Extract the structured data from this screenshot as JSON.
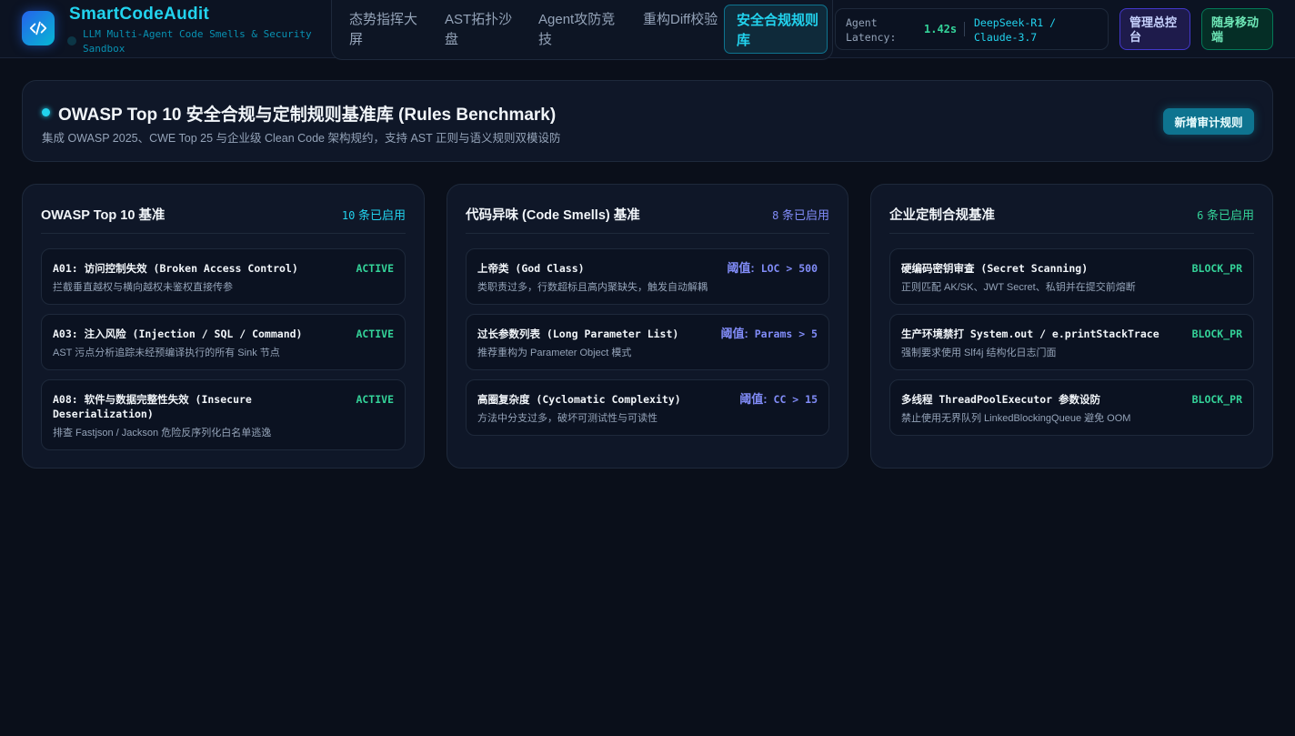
{
  "app": {
    "title": "SmartCodeAudit",
    "subtitle": "LLM Multi-Agent Code Smells & Security Sandbox"
  },
  "nav": {
    "tabs": [
      {
        "label": "态势指挥大屏",
        "active": false
      },
      {
        "label": "AST拓扑沙盘",
        "active": false
      },
      {
        "label": "Agent攻防竞技",
        "active": false
      },
      {
        "label": "重构Diff校验",
        "active": false
      },
      {
        "label": "安全合规规则库",
        "active": true
      }
    ]
  },
  "status": {
    "latency_label": "Agent Latency:",
    "latency_value": "1.42s",
    "models": "DeepSeek-R1 / Claude-3.7"
  },
  "buttons": {
    "admin": "管理总控台",
    "mobile": "随身移动端",
    "add_rule": "新增审计规则"
  },
  "header": {
    "title": "OWASP Top 10 安全合规与定制规则基准库 (Rules Benchmark)",
    "subtitle": "集成 OWASP 2025、CWE Top 25 与企业级 Clean Code 架构规约，支持 AST 正则与语义规则双模设防"
  },
  "panels": [
    {
      "title": "OWASP Top 10 基准",
      "count_num": "10",
      "count_suffix": " 条已启用",
      "accent": "#22d3ee",
      "rules": [
        {
          "name": "A01: 访问控制失效 (Broken Access Control)",
          "status": "ACTIVE",
          "desc": "拦截垂直越权与横向越权未鉴权直接传参"
        },
        {
          "name": "A03: 注入风险 (Injection / SQL / Command)",
          "status": "ACTIVE",
          "desc": "AST 污点分析追踪未经预编译执行的所有 Sink 节点"
        },
        {
          "name": "A08: 软件与数据完整性失效 (Insecure Deserialization)",
          "status": "ACTIVE",
          "desc": "排查 Fastjson / Jackson 危险反序列化白名单逃逸"
        }
      ]
    },
    {
      "title": "代码异味 (Code Smells) 基准",
      "count_num": "8",
      "count_suffix": " 条已启用",
      "accent": "#818cf8",
      "rules": [
        {
          "name": "上帝类 (God Class)",
          "status_label": "阈值:",
          "status": "LOC > 500",
          "desc": "类职责过多，行数超标且高内聚缺失，触发自动解耦"
        },
        {
          "name": "过长参数列表 (Long Parameter List)",
          "status_label": "阈值:",
          "status": "Params > 5",
          "desc": "推荐重构为 Parameter Object 模式"
        },
        {
          "name": "高圈复杂度 (Cyclomatic Complexity)",
          "status_label": "阈值:",
          "status": "CC > 15",
          "desc": "方法中分支过多，破坏可测试性与可读性"
        }
      ]
    },
    {
      "title": "企业定制合规基准",
      "count_num": "6",
      "count_suffix": " 条已启用",
      "accent": "#34d399",
      "rules": [
        {
          "name": "硬编码密钥审查 (Secret Scanning)",
          "status": "BLOCK_PR",
          "desc": "正则匹配 AK/SK、JWT Secret、私钥并在提交前熔断"
        },
        {
          "name": "生产环境禁打 System.out / e.printStackTrace",
          "status": "BLOCK_PR",
          "desc": "强制要求使用 Slf4j 结构化日志门面"
        },
        {
          "name": "多线程 ThreadPoolExecutor 参数设防",
          "status": "BLOCK_PR",
          "desc": "禁止使用无界队列 LinkedBlockingQueue 避免 OOM"
        }
      ]
    }
  ]
}
